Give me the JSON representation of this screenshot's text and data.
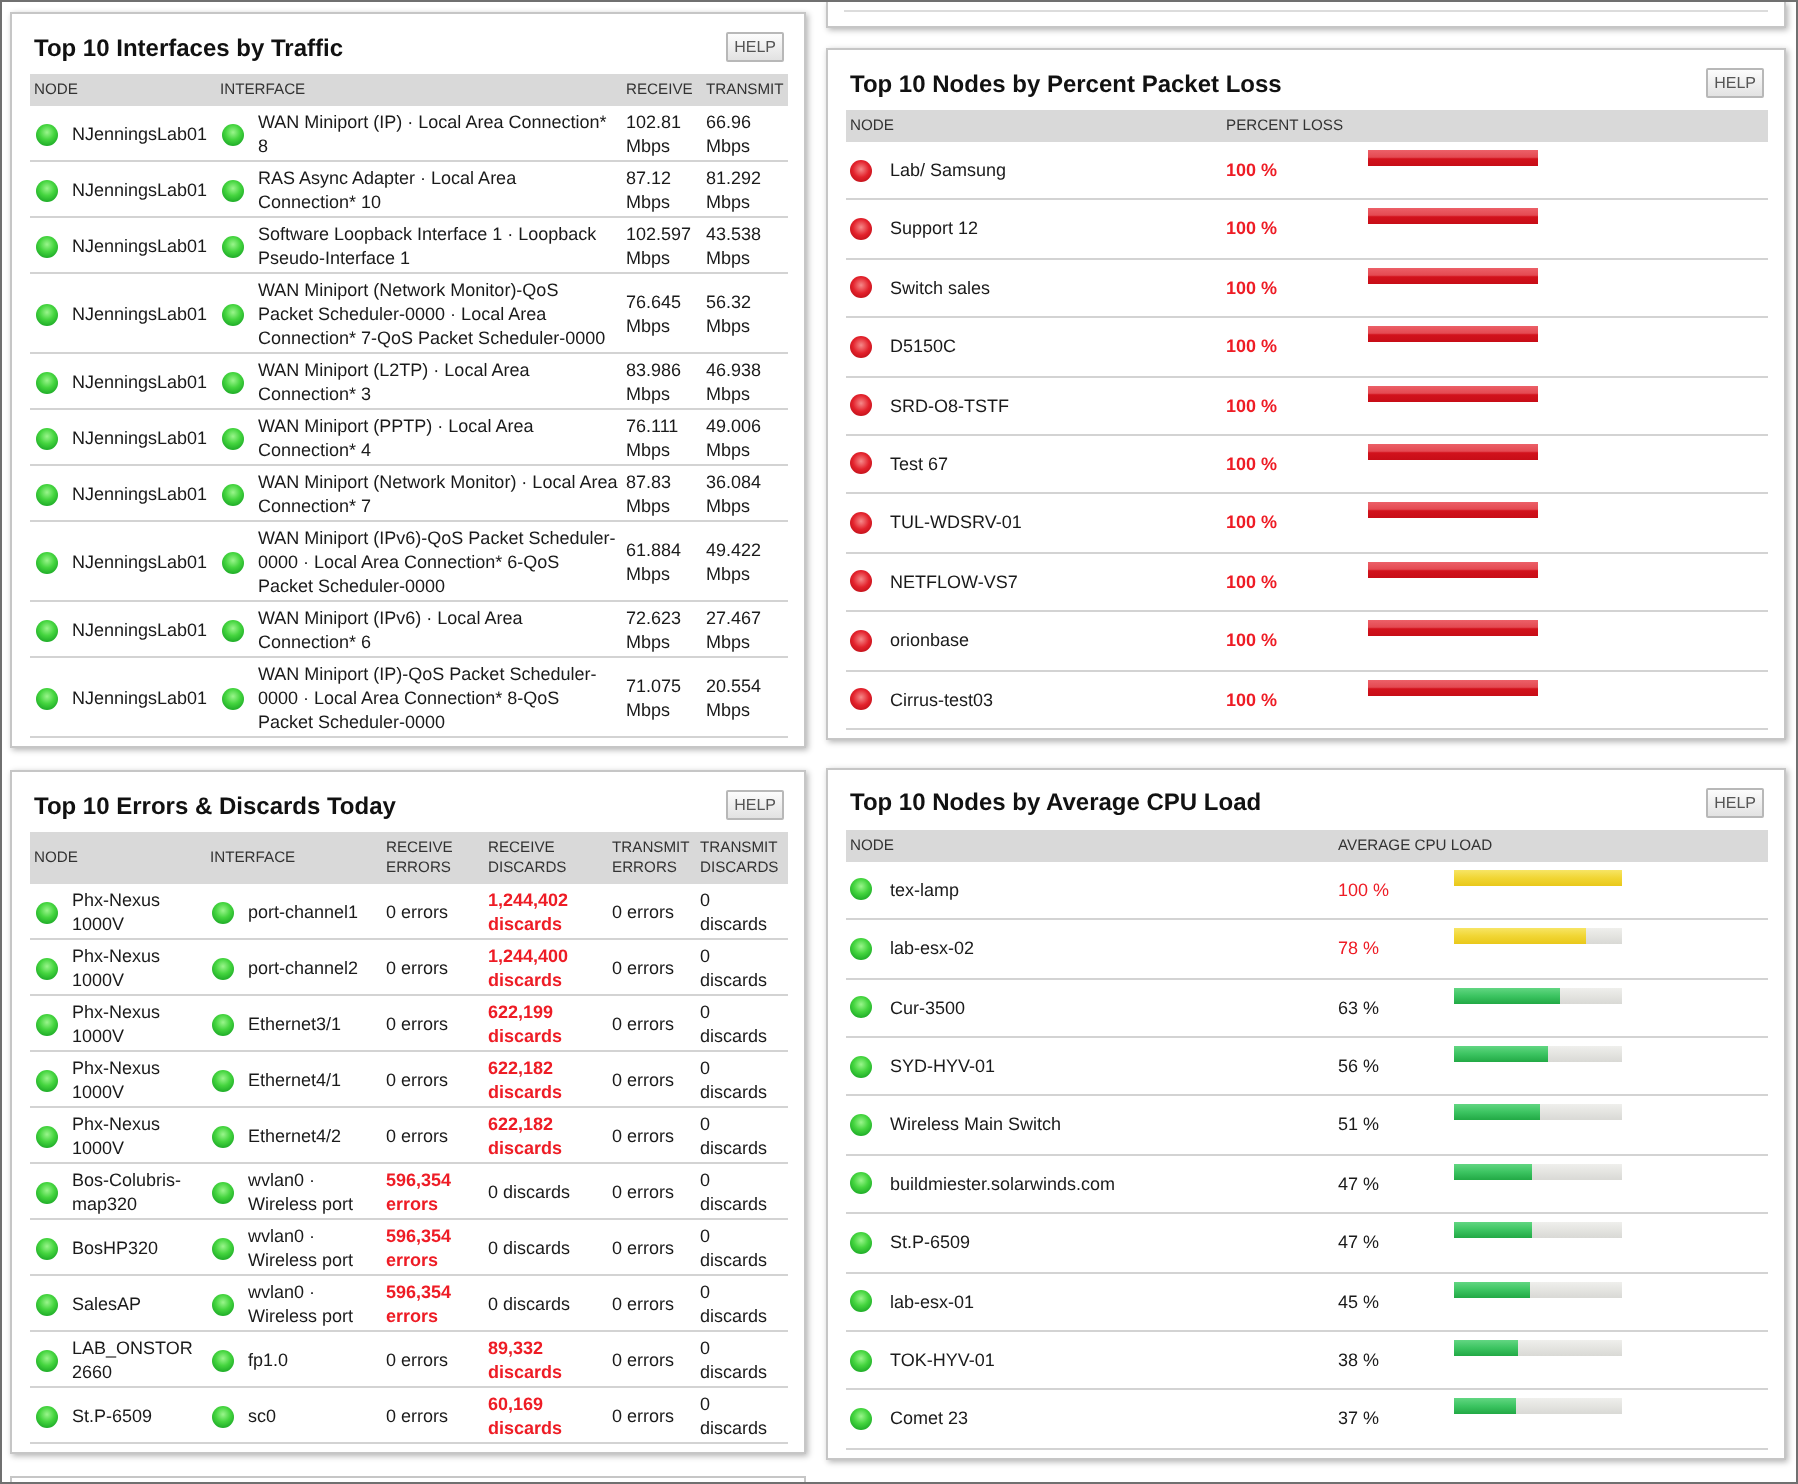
{
  "interfaces_by_traffic": {
    "title": "Top 10 Interfaces by Traffic",
    "help": "HELP",
    "columns": [
      "NODE",
      "INTERFACE",
      "RECEIVE",
      "TRANSMIT"
    ],
    "rows": [
      {
        "node": "NJenningsLab01",
        "node_up": true,
        "interface": "WAN Miniport (IP) · Local Area Connection* 8",
        "interface_up": true,
        "receive": "102.81 Mbps",
        "transmit": "66.96 Mbps"
      },
      {
        "node": "NJenningsLab01",
        "node_up": true,
        "interface": "RAS Async Adapter · Local Area Connection* 10",
        "interface_up": true,
        "receive": "87.12 Mbps",
        "transmit": "81.292 Mbps"
      },
      {
        "node": "NJenningsLab01",
        "node_up": true,
        "interface": "Software Loopback Interface 1 · Loopback Pseudo-Interface 1",
        "interface_up": true,
        "receive": "102.597 Mbps",
        "transmit": "43.538 Mbps"
      },
      {
        "node": "NJenningsLab01",
        "node_up": true,
        "interface": "WAN Miniport (Network Monitor)-QoS Packet Scheduler-0000 · Local Area Connection* 7-QoS Packet Scheduler-0000",
        "interface_up": true,
        "receive": "76.645 Mbps",
        "transmit": "56.32 Mbps"
      },
      {
        "node": "NJenningsLab01",
        "node_up": true,
        "interface": "WAN Miniport (L2TP) · Local Area Connection* 3",
        "interface_up": true,
        "receive": "83.986 Mbps",
        "transmit": "46.938 Mbps"
      },
      {
        "node": "NJenningsLab01",
        "node_up": true,
        "interface": "WAN Miniport (PPTP) · Local Area Connection* 4",
        "interface_up": true,
        "receive": "76.111 Mbps",
        "transmit": "49.006 Mbps"
      },
      {
        "node": "NJenningsLab01",
        "node_up": true,
        "interface": "WAN Miniport (Network Monitor) · Local Area Connection* 7",
        "interface_up": true,
        "receive": "87.83 Mbps",
        "transmit": "36.084 Mbps"
      },
      {
        "node": "NJenningsLab01",
        "node_up": true,
        "interface": "WAN Miniport (IPv6)-QoS Packet Scheduler-0000 · Local Area Connection* 6-QoS Packet Scheduler-0000",
        "interface_up": true,
        "receive": "61.884 Mbps",
        "transmit": "49.422 Mbps"
      },
      {
        "node": "NJenningsLab01",
        "node_up": true,
        "interface": "WAN Miniport (IPv6) · Local Area Connection* 6",
        "interface_up": true,
        "receive": "72.623 Mbps",
        "transmit": "27.467 Mbps"
      },
      {
        "node": "NJenningsLab01",
        "node_up": true,
        "interface": "WAN Miniport (IP)-QoS Packet Scheduler-0000 · Local Area Connection* 8-QoS Packet Scheduler-0000",
        "interface_up": true,
        "receive": "71.075 Mbps",
        "transmit": "20.554 Mbps"
      }
    ]
  },
  "nodes_by_packet_loss": {
    "title": "Top 10 Nodes by Percent Packet Loss",
    "help": "HELP",
    "columns": [
      "NODE",
      "PERCENT LOSS"
    ],
    "rows": [
      {
        "node": "Lab/ Samsung",
        "node_up": false,
        "loss": "100 %",
        "alert": true,
        "level": 1
      },
      {
        "node": "Support 12",
        "node_up": false,
        "loss": "100 %",
        "alert": true,
        "level": 1
      },
      {
        "node": "Switch sales",
        "node_up": false,
        "loss": "100 %",
        "alert": true,
        "level": 1
      },
      {
        "node": "D5150C",
        "node_up": false,
        "loss": "100 %",
        "alert": true,
        "level": 1
      },
      {
        "node": "SRD-O8-TSTF",
        "node_up": false,
        "loss": "100 %",
        "alert": true,
        "level": 1
      },
      {
        "node": "Test 67",
        "node_up": false,
        "loss": "100 %",
        "alert": true,
        "level": 1
      },
      {
        "node": "TUL-WDSRV-01",
        "node_up": false,
        "loss": "100 %",
        "alert": true,
        "level": 1
      },
      {
        "node": "NETFLOW-VS7",
        "node_up": false,
        "loss": "100 %",
        "alert": true,
        "level": 1
      },
      {
        "node": "orionbase",
        "node_up": false,
        "loss": "100 %",
        "alert": true,
        "level": 1
      },
      {
        "node": "Cirrus-test03",
        "node_up": false,
        "loss": "100 %",
        "alert": true,
        "level": 1
      }
    ]
  },
  "errors_and_discards": {
    "title": "Top 10 Errors & Discards Today",
    "help": "HELP",
    "columns": [
      "NODE",
      "INTERFACE",
      "RECEIVE ERRORS",
      "RECEIVE DISCARDS",
      "TRANSMIT ERRORS",
      "TRANSMIT DISCARDS"
    ],
    "rows": [
      {
        "node": "Phx-Nexus 1000V",
        "node_up": true,
        "interface": "port-channel1",
        "interface_up": true,
        "receive_errors": {
          "text": "0 errors",
          "alert": false
        },
        "receive_discards": {
          "text": "1,244,402 discards",
          "alert": true
        },
        "transmit_errors": {
          "text": "0 errors",
          "alert": false
        },
        "transmit_discards": {
          "text": "0 discards",
          "alert": false
        }
      },
      {
        "node": "Phx-Nexus 1000V",
        "node_up": true,
        "interface": "port-channel2",
        "interface_up": true,
        "receive_errors": {
          "text": "0 errors",
          "alert": false
        },
        "receive_discards": {
          "text": "1,244,400 discards",
          "alert": true
        },
        "transmit_errors": {
          "text": "0 errors",
          "alert": false
        },
        "transmit_discards": {
          "text": "0 discards",
          "alert": false
        }
      },
      {
        "node": "Phx-Nexus 1000V",
        "node_up": true,
        "interface": "Ethernet3/1",
        "interface_up": true,
        "receive_errors": {
          "text": "0 errors",
          "alert": false
        },
        "receive_discards": {
          "text": "622,199 discards",
          "alert": true
        },
        "transmit_errors": {
          "text": "0 errors",
          "alert": false
        },
        "transmit_discards": {
          "text": "0 discards",
          "alert": false
        }
      },
      {
        "node": "Phx-Nexus 1000V",
        "node_up": true,
        "interface": "Ethernet4/1",
        "interface_up": true,
        "receive_errors": {
          "text": "0 errors",
          "alert": false
        },
        "receive_discards": {
          "text": "622,182 discards",
          "alert": true
        },
        "transmit_errors": {
          "text": "0 errors",
          "alert": false
        },
        "transmit_discards": {
          "text": "0 discards",
          "alert": false
        }
      },
      {
        "node": "Phx-Nexus 1000V",
        "node_up": true,
        "interface": "Ethernet4/2",
        "interface_up": true,
        "receive_errors": {
          "text": "0 errors",
          "alert": false
        },
        "receive_discards": {
          "text": "622,182 discards",
          "alert": true
        },
        "transmit_errors": {
          "text": "0 errors",
          "alert": false
        },
        "transmit_discards": {
          "text": "0 discards",
          "alert": false
        }
      },
      {
        "node": "Bos-Colubris-map320",
        "node_up": true,
        "interface": "wvlan0 · Wireless port",
        "interface_up": true,
        "receive_errors": {
          "text": "596,354 errors",
          "alert": true
        },
        "receive_discards": {
          "text": "0 discards",
          "alert": false
        },
        "transmit_errors": {
          "text": "0 errors",
          "alert": false
        },
        "transmit_discards": {
          "text": "0 discards",
          "alert": false
        }
      },
      {
        "node": "BosHP320",
        "node_up": true,
        "interface": "wvlan0 · Wireless port",
        "interface_up": true,
        "receive_errors": {
          "text": "596,354 errors",
          "alert": true
        },
        "receive_discards": {
          "text": "0 discards",
          "alert": false
        },
        "transmit_errors": {
          "text": "0 errors",
          "alert": false
        },
        "transmit_discards": {
          "text": "0 discards",
          "alert": false
        }
      },
      {
        "node": "SalesAP",
        "node_up": true,
        "interface": "wvlan0 · Wireless port",
        "interface_up": true,
        "receive_errors": {
          "text": "596,354 errors",
          "alert": true
        },
        "receive_discards": {
          "text": "0 discards",
          "alert": false
        },
        "transmit_errors": {
          "text": "0 errors",
          "alert": false
        },
        "transmit_discards": {
          "text": "0 discards",
          "alert": false
        }
      },
      {
        "node": "LAB_ONSTOR 2660",
        "node_up": true,
        "interface": "fp1.0",
        "interface_up": true,
        "receive_errors": {
          "text": "0 errors",
          "alert": false
        },
        "receive_discards": {
          "text": "89,332 discards",
          "alert": true
        },
        "transmit_errors": {
          "text": "0 errors",
          "alert": false
        },
        "transmit_discards": {
          "text": "0 discards",
          "alert": false
        }
      },
      {
        "node": "St.P-6509",
        "node_up": true,
        "interface": "sc0",
        "interface_up": true,
        "receive_errors": {
          "text": "0 errors",
          "alert": false
        },
        "receive_discards": {
          "text": "60,169 discards",
          "alert": true
        },
        "transmit_errors": {
          "text": "0 errors",
          "alert": false
        },
        "transmit_discards": {
          "text": "0 discards",
          "alert": false
        }
      }
    ]
  },
  "nodes_by_cpu_load": {
    "title": "Top 10 Nodes by Average CPU Load",
    "help": "HELP",
    "columns": [
      "NODE",
      "AVERAGE CPU LOAD"
    ],
    "rows": [
      {
        "node": "tex-lamp",
        "node_up": true,
        "load": "100 %",
        "alert": true,
        "level": 1
      },
      {
        "node": "lab-esx-02",
        "node_up": true,
        "load": "78 %",
        "alert": true,
        "level": 0.78
      },
      {
        "node": "Cur-3500",
        "node_up": true,
        "load": "63 %",
        "alert": false,
        "level": 0.63
      },
      {
        "node": "SYD-HYV-01",
        "node_up": true,
        "load": "56 %",
        "alert": false,
        "level": 0.56
      },
      {
        "node": "Wireless Main Switch",
        "node_up": true,
        "load": "51 %",
        "alert": false,
        "level": 0.51
      },
      {
        "node": "buildmiester.solarwinds.com",
        "node_up": true,
        "load": "47 %",
        "alert": false,
        "level": 0.47
      },
      {
        "node": "St.P-6509",
        "node_up": true,
        "load": "47 %",
        "alert": false,
        "level": 0.47
      },
      {
        "node": "lab-esx-01",
        "node_up": true,
        "load": "45 %",
        "alert": false,
        "level": 0.45
      },
      {
        "node": "TOK-HYV-01",
        "node_up": true,
        "load": "38 %",
        "alert": false,
        "level": 0.38
      },
      {
        "node": "Comet 23",
        "node_up": true,
        "load": "37 %",
        "alert": false,
        "level": 0.37
      }
    ]
  }
}
